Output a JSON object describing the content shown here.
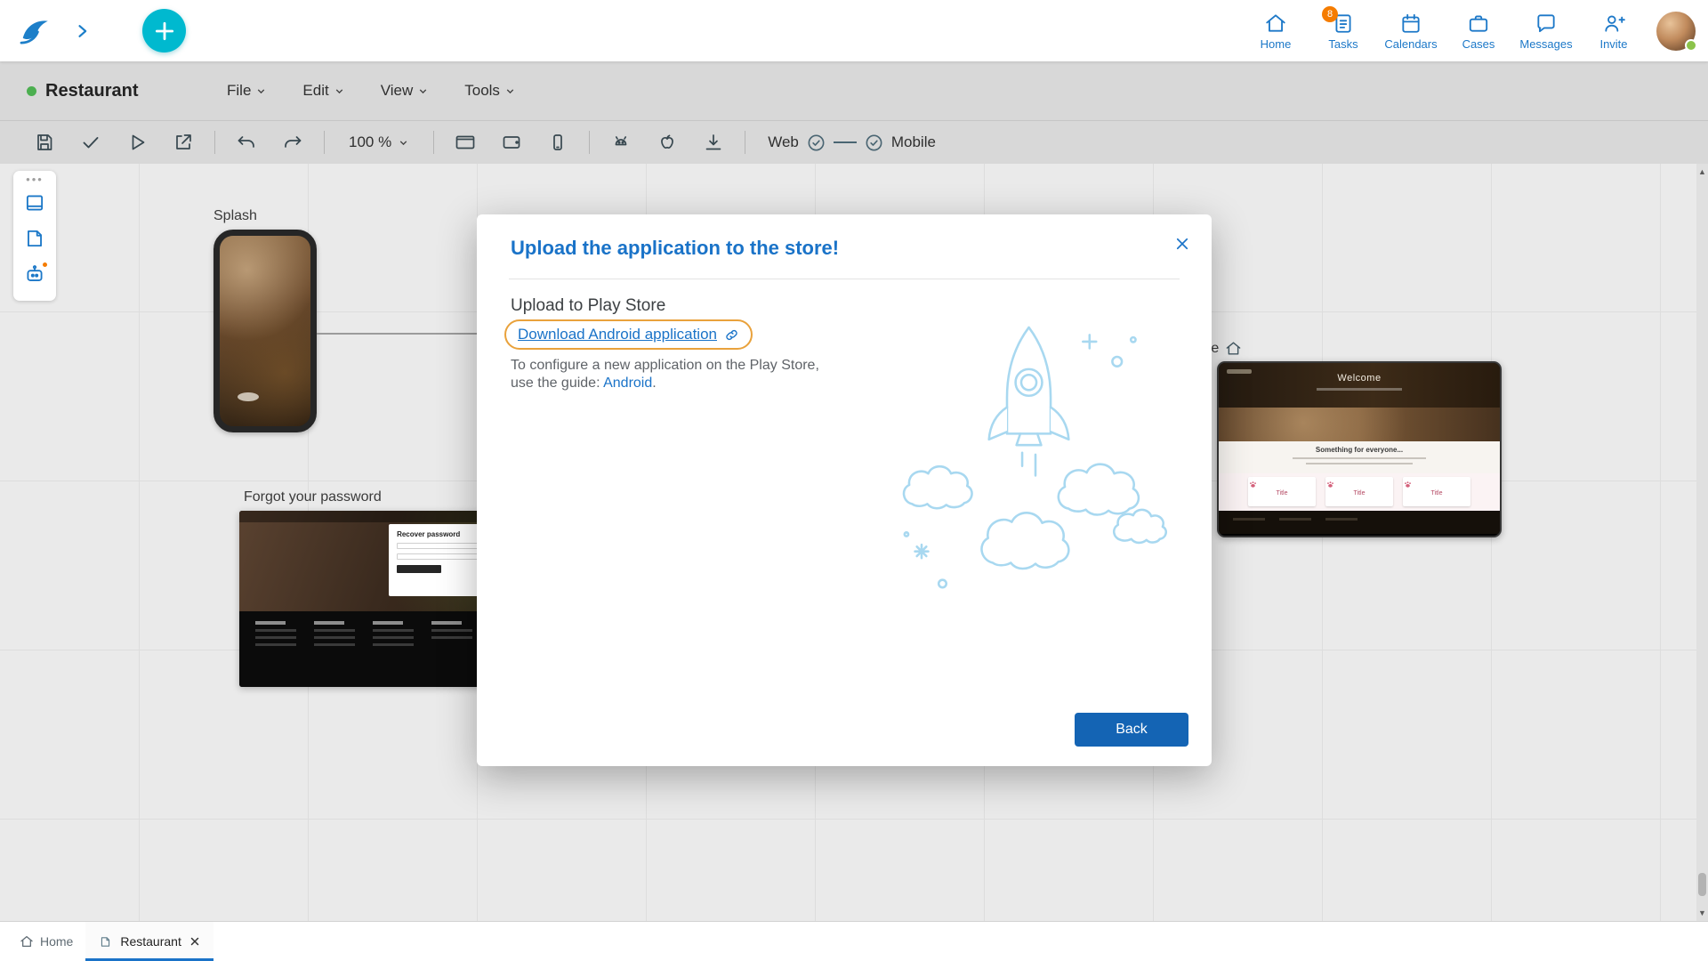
{
  "topbar": {
    "nav_items": [
      {
        "label": "Home",
        "icon": "home-icon"
      },
      {
        "label": "Tasks",
        "icon": "tasks-icon",
        "badge": "8"
      },
      {
        "label": "Calendars",
        "icon": "calendar-icon"
      },
      {
        "label": "Cases",
        "icon": "briefcase-icon"
      },
      {
        "label": "Messages",
        "icon": "message-icon"
      },
      {
        "label": "Invite",
        "icon": "invite-icon"
      }
    ]
  },
  "menubar": {
    "project_name": "Restaurant",
    "menu_file": "File",
    "menu_edit": "Edit",
    "menu_view": "View",
    "menu_tools": "Tools"
  },
  "toolbar": {
    "zoom_value": "100 %",
    "web_label": "Web",
    "mobile_label": "Mobile",
    "buttons": [
      "save-icon",
      "check-icon",
      "preview-icon",
      "export-icon",
      "undo-icon",
      "redo-icon",
      "desktop-frame-icon",
      "tablet-frame-icon",
      "phone-frame-icon",
      "android-icon",
      "apple-icon",
      "download-icon"
    ]
  },
  "canvas": {
    "splash_label": "Splash",
    "forgot_password_label": "Forgot your password",
    "home_artboard_label": "me",
    "recover_card_title": "Recover password",
    "welcome_heading": "Welcome",
    "something_heading": "Something for everyone...",
    "card_title": "Title"
  },
  "modal": {
    "title": "Upload the application to the store!",
    "section_heading": "Upload to Play Store",
    "download_link": "Download Android application",
    "body_line1": "To configure a new application on the Play Store,",
    "body_line2": "use the guide:",
    "body_link": "Android",
    "body_period": ".",
    "back_button": "Back"
  },
  "tabs": {
    "home_tab": "Home",
    "restaurant_tab": "Restaurant"
  },
  "colors": {
    "accent_blue": "#1a73c8",
    "teal_plus": "#00b9cf",
    "badge_orange": "#f57c00",
    "highlight_orange": "#e9a23c",
    "back_button_blue": "#1464b4",
    "status_green": "#4caf50",
    "illustration_blue": "#a8d8f0"
  }
}
